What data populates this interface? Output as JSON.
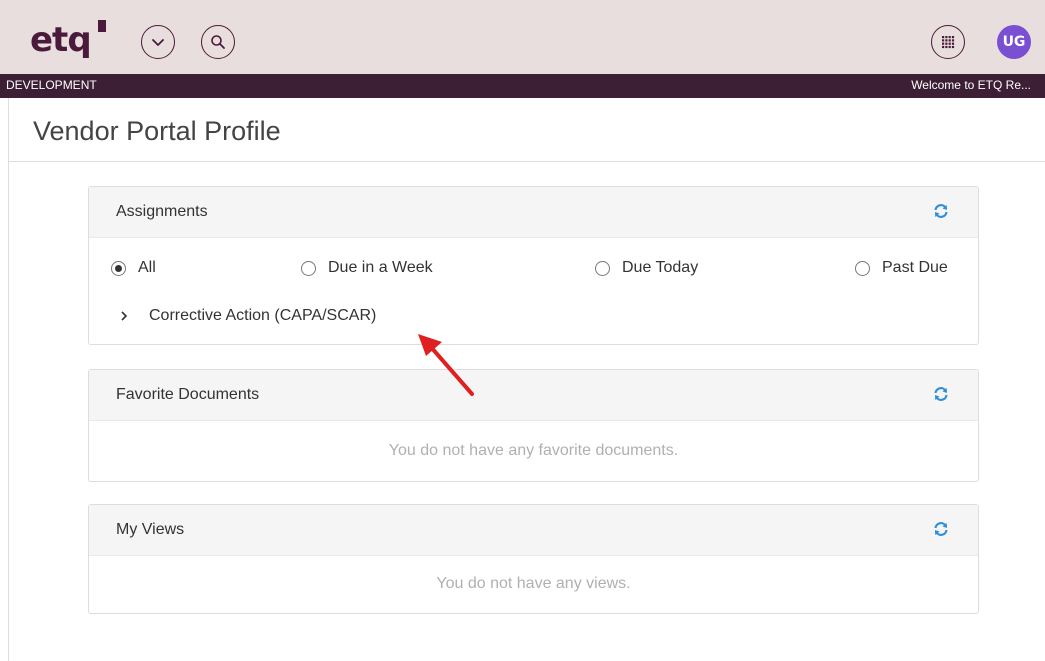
{
  "header": {
    "logo_text": "etq",
    "icons": [
      "chevron-down-icon",
      "search-icon",
      "apps-grid-icon"
    ],
    "avatar_initials": "UG",
    "avatar_color": "#7b4fd1",
    "brand_color": "#4a1a3a"
  },
  "envbar": {
    "environment": "DEVELOPMENT",
    "welcome": "Welcome to ETQ Re..."
  },
  "page": {
    "title": "Vendor Portal Profile"
  },
  "assignments": {
    "title": "Assignments",
    "filters": [
      {
        "label": "All",
        "checked": true
      },
      {
        "label": "Due in a Week",
        "checked": false
      },
      {
        "label": "Due Today",
        "checked": false
      },
      {
        "label": "Past Due",
        "checked": false
      }
    ],
    "items": [
      {
        "label": "Corrective Action (CAPA/SCAR)"
      }
    ]
  },
  "favorites": {
    "title": "Favorite Documents",
    "empty_message": "You do not have any favorite documents."
  },
  "views": {
    "title": "My Views",
    "empty_message": "You do not have any views."
  },
  "colors": {
    "refresh_icon": "#2f8fd8",
    "annotation_arrow": "#e02020",
    "envbar": "#3c1f35",
    "topbar": "#e9dede"
  }
}
